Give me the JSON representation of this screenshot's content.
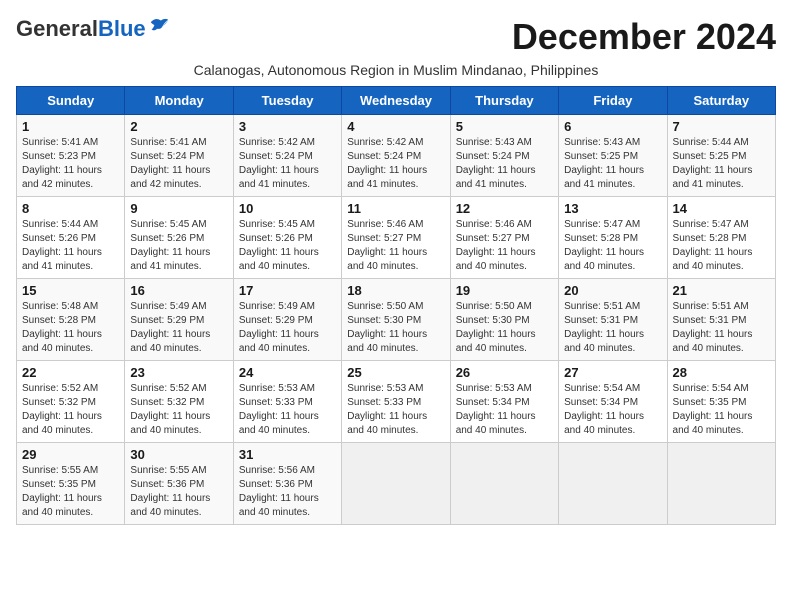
{
  "header": {
    "logo_general": "General",
    "logo_blue": "Blue",
    "month_title": "December 2024",
    "subtitle": "Calanogas, Autonomous Region in Muslim Mindanao, Philippines"
  },
  "weekdays": [
    "Sunday",
    "Monday",
    "Tuesday",
    "Wednesday",
    "Thursday",
    "Friday",
    "Saturday"
  ],
  "weeks": [
    [
      {
        "day": "1",
        "info": "Sunrise: 5:41 AM\nSunset: 5:23 PM\nDaylight: 11 hours\nand 42 minutes."
      },
      {
        "day": "2",
        "info": "Sunrise: 5:41 AM\nSunset: 5:24 PM\nDaylight: 11 hours\nand 42 minutes."
      },
      {
        "day": "3",
        "info": "Sunrise: 5:42 AM\nSunset: 5:24 PM\nDaylight: 11 hours\nand 41 minutes."
      },
      {
        "day": "4",
        "info": "Sunrise: 5:42 AM\nSunset: 5:24 PM\nDaylight: 11 hours\nand 41 minutes."
      },
      {
        "day": "5",
        "info": "Sunrise: 5:43 AM\nSunset: 5:24 PM\nDaylight: 11 hours\nand 41 minutes."
      },
      {
        "day": "6",
        "info": "Sunrise: 5:43 AM\nSunset: 5:25 PM\nDaylight: 11 hours\nand 41 minutes."
      },
      {
        "day": "7",
        "info": "Sunrise: 5:44 AM\nSunset: 5:25 PM\nDaylight: 11 hours\nand 41 minutes."
      }
    ],
    [
      {
        "day": "8",
        "info": "Sunrise: 5:44 AM\nSunset: 5:26 PM\nDaylight: 11 hours\nand 41 minutes."
      },
      {
        "day": "9",
        "info": "Sunrise: 5:45 AM\nSunset: 5:26 PM\nDaylight: 11 hours\nand 41 minutes."
      },
      {
        "day": "10",
        "info": "Sunrise: 5:45 AM\nSunset: 5:26 PM\nDaylight: 11 hours\nand 40 minutes."
      },
      {
        "day": "11",
        "info": "Sunrise: 5:46 AM\nSunset: 5:27 PM\nDaylight: 11 hours\nand 40 minutes."
      },
      {
        "day": "12",
        "info": "Sunrise: 5:46 AM\nSunset: 5:27 PM\nDaylight: 11 hours\nand 40 minutes."
      },
      {
        "day": "13",
        "info": "Sunrise: 5:47 AM\nSunset: 5:28 PM\nDaylight: 11 hours\nand 40 minutes."
      },
      {
        "day": "14",
        "info": "Sunrise: 5:47 AM\nSunset: 5:28 PM\nDaylight: 11 hours\nand 40 minutes."
      }
    ],
    [
      {
        "day": "15",
        "info": "Sunrise: 5:48 AM\nSunset: 5:28 PM\nDaylight: 11 hours\nand 40 minutes."
      },
      {
        "day": "16",
        "info": "Sunrise: 5:49 AM\nSunset: 5:29 PM\nDaylight: 11 hours\nand 40 minutes."
      },
      {
        "day": "17",
        "info": "Sunrise: 5:49 AM\nSunset: 5:29 PM\nDaylight: 11 hours\nand 40 minutes."
      },
      {
        "day": "18",
        "info": "Sunrise: 5:50 AM\nSunset: 5:30 PM\nDaylight: 11 hours\nand 40 minutes."
      },
      {
        "day": "19",
        "info": "Sunrise: 5:50 AM\nSunset: 5:30 PM\nDaylight: 11 hours\nand 40 minutes."
      },
      {
        "day": "20",
        "info": "Sunrise: 5:51 AM\nSunset: 5:31 PM\nDaylight: 11 hours\nand 40 minutes."
      },
      {
        "day": "21",
        "info": "Sunrise: 5:51 AM\nSunset: 5:31 PM\nDaylight: 11 hours\nand 40 minutes."
      }
    ],
    [
      {
        "day": "22",
        "info": "Sunrise: 5:52 AM\nSunset: 5:32 PM\nDaylight: 11 hours\nand 40 minutes."
      },
      {
        "day": "23",
        "info": "Sunrise: 5:52 AM\nSunset: 5:32 PM\nDaylight: 11 hours\nand 40 minutes."
      },
      {
        "day": "24",
        "info": "Sunrise: 5:53 AM\nSunset: 5:33 PM\nDaylight: 11 hours\nand 40 minutes."
      },
      {
        "day": "25",
        "info": "Sunrise: 5:53 AM\nSunset: 5:33 PM\nDaylight: 11 hours\nand 40 minutes."
      },
      {
        "day": "26",
        "info": "Sunrise: 5:53 AM\nSunset: 5:34 PM\nDaylight: 11 hours\nand 40 minutes."
      },
      {
        "day": "27",
        "info": "Sunrise: 5:54 AM\nSunset: 5:34 PM\nDaylight: 11 hours\nand 40 minutes."
      },
      {
        "day": "28",
        "info": "Sunrise: 5:54 AM\nSunset: 5:35 PM\nDaylight: 11 hours\nand 40 minutes."
      }
    ],
    [
      {
        "day": "29",
        "info": "Sunrise: 5:55 AM\nSunset: 5:35 PM\nDaylight: 11 hours\nand 40 minutes."
      },
      {
        "day": "30",
        "info": "Sunrise: 5:55 AM\nSunset: 5:36 PM\nDaylight: 11 hours\nand 40 minutes."
      },
      {
        "day": "31",
        "info": "Sunrise: 5:56 AM\nSunset: 5:36 PM\nDaylight: 11 hours\nand 40 minutes."
      },
      {
        "day": "",
        "info": ""
      },
      {
        "day": "",
        "info": ""
      },
      {
        "day": "",
        "info": ""
      },
      {
        "day": "",
        "info": ""
      }
    ]
  ]
}
